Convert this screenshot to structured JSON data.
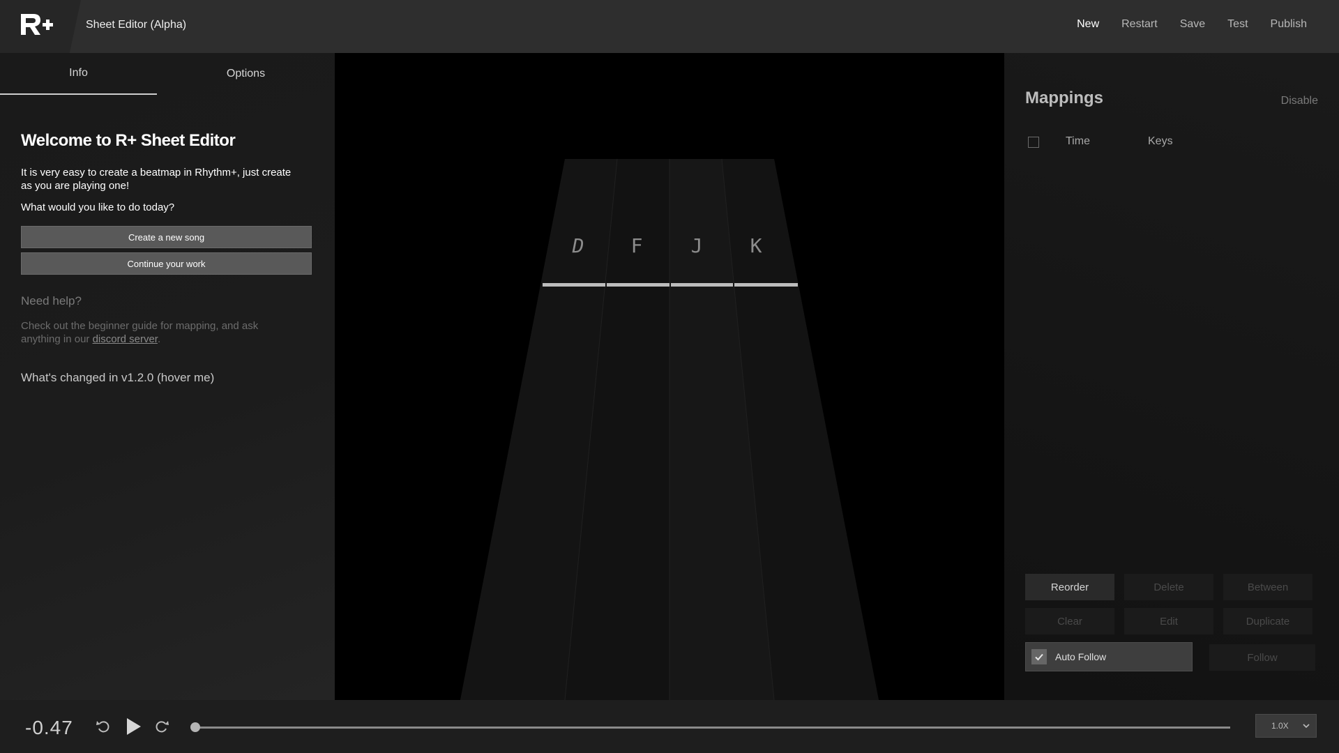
{
  "header": {
    "logo_text": "R+",
    "title": "Sheet Editor (Alpha)",
    "nav": [
      {
        "label": "New"
      },
      {
        "label": "Restart"
      },
      {
        "label": "Save"
      },
      {
        "label": "Test"
      },
      {
        "label": "Publish"
      }
    ]
  },
  "left_panel": {
    "tabs": [
      {
        "label": "Info"
      },
      {
        "label": "Options"
      }
    ],
    "active_tab": "Info",
    "welcome_title": "Welcome to R+ Sheet Editor",
    "intro": "It is very easy to create a beatmap in Rhythm+, just create as you are playing one!",
    "question": "What would you like to do today?",
    "buttons": {
      "create": "Create a new song",
      "continue": "Continue your work"
    },
    "help": {
      "title": "Need help?",
      "text_before": "Check out the beginner guide for mapping, and ask anything in our ",
      "link": "discord server",
      "text_after": "."
    },
    "changed": "What's changed in v1.2.0 (hover me)"
  },
  "stage": {
    "lane_keys": [
      "D",
      "F",
      "J",
      "K"
    ]
  },
  "right_panel": {
    "title": "Mappings",
    "disable": "Disable",
    "columns": {
      "time": "Time",
      "keys": "Keys"
    },
    "actions": [
      {
        "label": "Reorder",
        "enabled": true
      },
      {
        "label": "Delete",
        "enabled": false
      },
      {
        "label": "Between",
        "enabled": false
      },
      {
        "label": "Clear",
        "enabled": false
      },
      {
        "label": "Edit",
        "enabled": false
      },
      {
        "label": "Duplicate",
        "enabled": false
      }
    ],
    "auto_follow": {
      "label": "Auto Follow",
      "checked": true
    },
    "follow": "Follow"
  },
  "playback": {
    "time": "-0.47",
    "speed": "1.0X",
    "progress": 0.0
  },
  "colors": {
    "header_bg": "#2e2e2e",
    "panel_bg": "#1a1a1a",
    "button_bg": "#595959",
    "disabled_text": "#4a4a4a"
  }
}
